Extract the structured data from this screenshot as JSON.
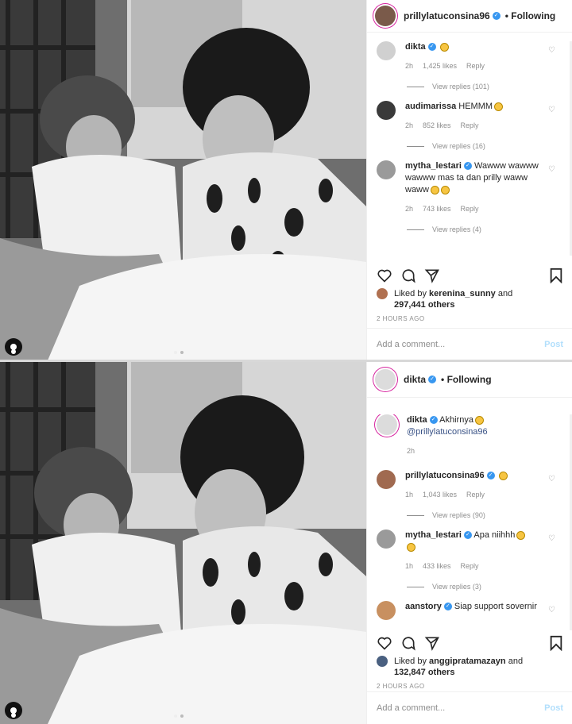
{
  "post1": {
    "username": "prillylatuconsina96",
    "follow_label": "Following",
    "comments": [
      {
        "user": "dikta",
        "text": "",
        "time": "2h",
        "likes": "1,425 likes",
        "reply": "Reply",
        "view_replies": "View replies (101)"
      },
      {
        "user": "audimarissa",
        "text": "HEMMM",
        "time": "2h",
        "likes": "852 likes",
        "reply": "Reply",
        "view_replies": "View replies (16)"
      },
      {
        "user": "mytha_lestari",
        "text": "Wawww wawww wawww mas ta dan prilly waww waww",
        "time": "2h",
        "likes": "743 likes",
        "reply": "Reply",
        "view_replies": "View replies (4)"
      }
    ],
    "liked_by_prefix": "Liked by",
    "liked_by_user": "kerenina_sunny",
    "liked_by_suffix": "and",
    "liked_others": "297,441 others",
    "timestamp": "2 HOURS AGO",
    "add_comment_placeholder": "Add a comment...",
    "post_label": "Post"
  },
  "post2": {
    "username": "dikta",
    "follow_label": "Following",
    "caption_user": "dikta",
    "caption_text": "Akhirnya",
    "caption_mention": "@prillylatuconsina96",
    "caption_time": "2h",
    "comments": [
      {
        "user": "prillylatuconsina96",
        "text": "",
        "time": "1h",
        "likes": "1,043 likes",
        "reply": "Reply",
        "view_replies": "View replies (90)"
      },
      {
        "user": "mytha_lestari",
        "text": "Apa niihhh",
        "time": "1h",
        "likes": "433 likes",
        "reply": "Reply",
        "view_replies": "View replies (3)"
      },
      {
        "user": "aanstory",
        "text": "Siap support sovernir",
        "time": "",
        "likes": "",
        "reply": "",
        "view_replies": ""
      }
    ],
    "liked_by_prefix": "Liked by",
    "liked_by_user": "anggipratamazayn",
    "liked_by_suffix": "and",
    "liked_others": "132,847 others",
    "timestamp": "2 HOURS AGO",
    "add_comment_placeholder": "Add a comment...",
    "post_label": "Post"
  },
  "colors": {
    "verified": "#3897f0",
    "link": "#385185",
    "post_disabled": "#b2dffc",
    "muted": "#8e8e8e"
  },
  "icons": [
    "heart-icon",
    "comment-icon",
    "share-icon",
    "bookmark-icon",
    "verified-icon",
    "tag-person-icon"
  ]
}
